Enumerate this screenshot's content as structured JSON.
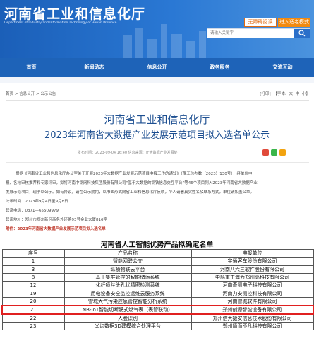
{
  "header": {
    "site_title": "河南省工业和信息化厅",
    "site_subtitle": "Department of Industry and Information Technology of Henan Province",
    "btn_accessible": "无障碍阅读",
    "btn_elder": "进入适老模式",
    "search_placeholder": "请输入关键字"
  },
  "nav": [
    "首页",
    "新闻动态",
    "信息公开",
    "政务服务",
    "交流互动"
  ],
  "breadcrumb": "首页 > 信息公开 > 公示公告",
  "print_bar": {
    "print": "[打印]",
    "font_label": "【字体:",
    "large": "大",
    "medium": "中",
    "small": "小】"
  },
  "article": {
    "title_line1": "河南省工业和信息化厅",
    "title_line2": "2023年河南省大数据产业发展示范项目拟入选名单公示",
    "meta": "发布时间：2023-09-04 16:40    信息来源：厅大数据产业发展处",
    "para1_l1": "根据《河南省工业和信息化厅办公室关于开展2023年大数据产业发展示范项目申报工作的通知》（豫工信办数（2023）130号），经单位申",
    "para1_l2": "报、各地审核推荐和专家评审，拟将河南中钢网科技集团股份有限公司“基于大数据的钢铁信息交互平台”等46个项目列入2023年河南省大数据产业",
    "para1_l3": "发展示范项目，现予以公示。如有异议，请在公示期内，以书面形式向省工业和信息化厅反映，个人请署真实姓名及联系方式，单位请加盖公章。",
    "notice_period": "公示时间：2023年9月4日至9月8日",
    "phone": "联系电话：0371—65509979",
    "address": "联系地址：郑州市郑东新区商务外环路93号金业大厦816室",
    "attachment": "附件：2023年河南省大数据产业发展示范项目拟入选名单"
  },
  "table": {
    "title": "河南省人工智能优势产品拟确定名单",
    "headers": [
      "序号",
      "产品名称",
      "申报单位"
    ],
    "rows": [
      [
        "1",
        "智能网联公交",
        "宇通客车股份有限公司"
      ],
      [
        "3",
        "纵横物联云平台",
        "河南八六三软件股份有限公司"
      ],
      [
        "8",
        "基于集群管控的智能储运系统",
        "中船重工海为郑州高科技有限公司"
      ],
      [
        "12",
        "化纤喷丝头孔状精密检测系统",
        "河南奇测电子科技有限公司"
      ],
      [
        "19",
        "用电设备安全监控运维云服务系统",
        "河南力安测控科技有限公司"
      ],
      [
        "20",
        "雪城大气污染应急管控智能分析系统",
        "河南雪城软件有限公司"
      ],
      [
        "21",
        "NB-IoT智能切断膜式燃气表（表管联动）",
        "郑州创源智能设备有限公司"
      ],
      [
        "22",
        "人脸识别",
        "郑州信大捷安信息技术股份有限公司"
      ],
      [
        "23",
        "义齿数据3D建模综合处理平台",
        "郑州简而不凡科技有限公司"
      ]
    ],
    "highlight_row_index": 6
  },
  "colors": {
    "header_blue": "#1b5fb8",
    "nav_blue": "#1e63b8",
    "title_blue": "#1d4f91",
    "orange": "#f28a10",
    "highlight_red": "#e02020"
  }
}
